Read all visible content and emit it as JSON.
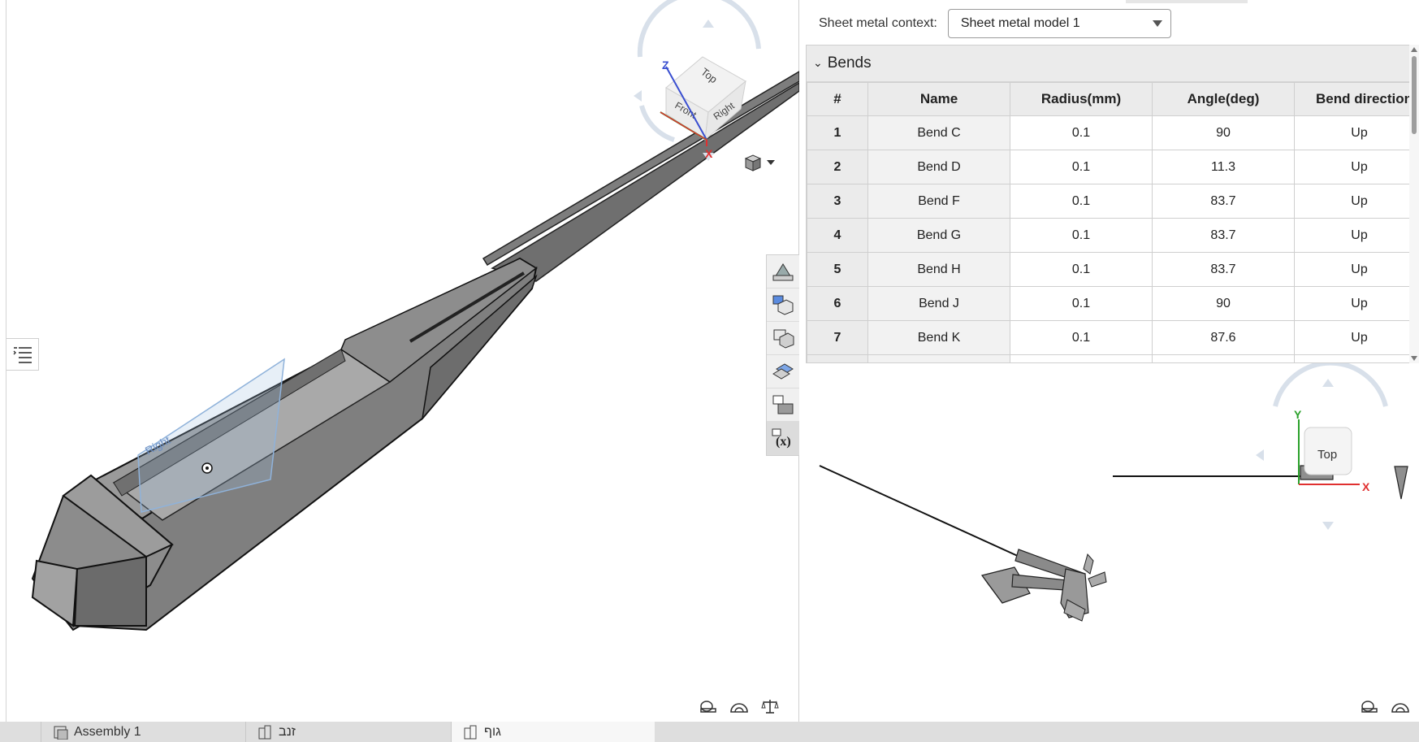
{
  "viewport": {
    "view_cube": {
      "top": "Top",
      "front": "Front",
      "right": "Right",
      "axis_z": "Z",
      "axis_x": "X"
    },
    "flat_view_cube": {
      "top": "Top",
      "axis_y": "Y",
      "axis_x": "X"
    },
    "toolbar_icons": [
      "sheet-metal-icon",
      "flat-pattern-icon",
      "bend-table-icon",
      "form-tool-icon",
      "bend-list-icon",
      "variable-table-icon"
    ]
  },
  "sheet_metal": {
    "context_label": "Sheet metal context:",
    "context_value": "Sheet metal model 1",
    "section_title": "Bends",
    "columns": [
      "#",
      "Name",
      "Radius(mm)",
      "Angle(deg)",
      "Bend direction"
    ],
    "rows": [
      {
        "index": "1",
        "name": "Bend C",
        "radius": "0.1",
        "angle": "90",
        "direction": "Up"
      },
      {
        "index": "2",
        "name": "Bend D",
        "radius": "0.1",
        "angle": "11.3",
        "direction": "Up"
      },
      {
        "index": "3",
        "name": "Bend F",
        "radius": "0.1",
        "angle": "83.7",
        "direction": "Up"
      },
      {
        "index": "4",
        "name": "Bend G",
        "radius": "0.1",
        "angle": "83.7",
        "direction": "Up"
      },
      {
        "index": "5",
        "name": "Bend H",
        "radius": "0.1",
        "angle": "83.7",
        "direction": "Up"
      },
      {
        "index": "6",
        "name": "Bend J",
        "radius": "0.1",
        "angle": "90",
        "direction": "Up"
      },
      {
        "index": "7",
        "name": "Bend K",
        "radius": "0.1",
        "angle": "87.6",
        "direction": "Up"
      }
    ]
  },
  "tabs": [
    {
      "label": "Assembly 1"
    },
    {
      "label": "זנב"
    },
    {
      "label": "גוף"
    }
  ],
  "colors": {
    "accent_red": "#e03030",
    "accent_green": "#2aa12a",
    "accent_blue": "#3a4fd0",
    "model_gray": "#8a8a8a"
  }
}
